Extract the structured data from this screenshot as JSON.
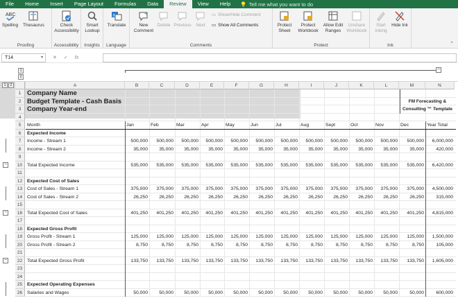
{
  "menu": {
    "tabs": [
      "File",
      "Home",
      "Insert",
      "Page Layout",
      "Formulas",
      "Data",
      "Review",
      "View",
      "Help"
    ],
    "active": "Review",
    "tell": "Tell me what you want to do"
  },
  "ribbon": {
    "proofing": {
      "spelling": "Spelling",
      "thesaurus": "Thesaurus",
      "label": "Proofing"
    },
    "accessibility": {
      "check": "Check Accessibility",
      "label": "Accessibility"
    },
    "insights": {
      "smart": "Smart Lookup",
      "label": "Insights"
    },
    "language": {
      "translate": "Translate",
      "label": "Language"
    },
    "comments": {
      "new": "New Comment",
      "delete": "Delete",
      "previous": "Previous",
      "next": "Next",
      "showhide": "Show/Hide Comment",
      "showall": "Show All Comments",
      "label": "Comments"
    },
    "protect": {
      "sheet": "Protect Sheet",
      "workbook": "Protect Workbook",
      "allow": "Allow Edit Ranges",
      "unshare": "Unshare Workbook",
      "label": "Protect"
    },
    "ink": {
      "start": "Start Inking",
      "hide": "Hide Ink",
      "label": "Ink"
    }
  },
  "formula": {
    "namebox": "T14",
    "cancel": "✕",
    "enter": "✓",
    "fx": "fx",
    "value": ""
  },
  "outline": {
    "levels_row": [
      "1",
      "2"
    ],
    "levels_col": [
      "1",
      "2"
    ]
  },
  "columns": [
    "A",
    "B",
    "C",
    "D",
    "E",
    "F",
    "G",
    "H",
    "I",
    "J",
    "K",
    "L",
    "M",
    "N"
  ],
  "rows": [
    {
      "n": "1",
      "a": "Company Name",
      "style": "big"
    },
    {
      "n": "2",
      "a": "Budget Template - Cash Basis",
      "style": "big",
      "n_text": "FM Forecasting &"
    },
    {
      "n": "3",
      "a": "Company Year-end",
      "style": "big",
      "n_text": "Consulting ™ Template"
    },
    {
      "n": "4",
      "a": ""
    },
    {
      "n": "5",
      "a": "Month",
      "months": [
        "Jan",
        "Feb",
        "Mar",
        "Apr",
        "May",
        "Jun",
        "Jul",
        "Aug",
        "Sept",
        "Oct",
        "Nov",
        "Dec"
      ],
      "total": "Year Total"
    },
    {
      "n": "6",
      "a": "Expected Income",
      "style": "bold"
    },
    {
      "n": "7",
      "a": "Income - Stream 1",
      "shade": true,
      "vals": [
        "500,000",
        "500,000",
        "500,000",
        "500,000",
        "500,000",
        "500,000",
        "500,000",
        "500,000",
        "500,000",
        "500,000",
        "500,000",
        "500,000"
      ],
      "total": "6,000,000"
    },
    {
      "n": "8",
      "a": "Income - Stream 2",
      "shade": true,
      "vals": [
        "35,000",
        "35,000",
        "35,000",
        "35,000",
        "35,000",
        "35,000",
        "35,000",
        "35,000",
        "35,000",
        "35,000",
        "35,000",
        "35,000"
      ],
      "total": "420,000"
    },
    {
      "n": "9",
      "a": ""
    },
    {
      "n": "10",
      "a": "Total Expected Income",
      "vals": [
        "535,000",
        "535,000",
        "535,000",
        "535,000",
        "535,000",
        "535,000",
        "535,000",
        "535,000",
        "535,000",
        "535,000",
        "535,000",
        "535,000"
      ],
      "total": "6,420,000"
    },
    {
      "n": "11",
      "a": ""
    },
    {
      "n": "12",
      "a": "Expected Cost of Sales",
      "style": "bold"
    },
    {
      "n": "13",
      "a": "Cost of Sales - Stream 1",
      "shade": true,
      "vals": [
        "375,000",
        "375,000",
        "375,000",
        "375,000",
        "375,000",
        "375,000",
        "375,000",
        "375,000",
        "375,000",
        "375,000",
        "375,000",
        "375,000"
      ],
      "total": "4,500,000"
    },
    {
      "n": "14",
      "a": "Cost of Sales - Stream 2",
      "shade": true,
      "vals": [
        "26,250",
        "26,250",
        "26,250",
        "26,250",
        "26,250",
        "26,250",
        "26,250",
        "26,250",
        "26,250",
        "26,250",
        "26,250",
        "26,250"
      ],
      "total": "315,000"
    },
    {
      "n": "15",
      "a": ""
    },
    {
      "n": "16",
      "a": "Total Expected Cost of Sales",
      "vals": [
        "401,250",
        "401,250",
        "401,250",
        "401,250",
        "401,250",
        "401,250",
        "401,250",
        "401,250",
        "401,250",
        "401,250",
        "401,250",
        "401,250"
      ],
      "total": "4,815,000"
    },
    {
      "n": "17",
      "a": ""
    },
    {
      "n": "18",
      "a": "Expected Gross Profit",
      "style": "bold"
    },
    {
      "n": "19",
      "a": "Gross Profit - Stream 1",
      "vals": [
        "125,000",
        "125,000",
        "125,000",
        "125,000",
        "125,000",
        "125,000",
        "125,000",
        "125,000",
        "125,000",
        "125,000",
        "125,000",
        "125,000"
      ],
      "total": "1,500,000"
    },
    {
      "n": "20",
      "a": "Gross Profit - Stream 2",
      "vals": [
        "8,750",
        "8,750",
        "8,750",
        "8,750",
        "8,750",
        "8,750",
        "8,750",
        "8,750",
        "8,750",
        "8,750",
        "8,750",
        "8,750"
      ],
      "total": "105,000"
    },
    {
      "n": "21",
      "a": ""
    },
    {
      "n": "22",
      "a": "Total Expected Gross Profit",
      "vals": [
        "133,750",
        "133,750",
        "133,750",
        "133,750",
        "133,750",
        "133,750",
        "133,750",
        "133,750",
        "133,750",
        "133,750",
        "133,750",
        "133,750"
      ],
      "total": "1,605,000"
    },
    {
      "n": "23",
      "a": ""
    },
    {
      "n": "24",
      "a": ""
    },
    {
      "n": "25",
      "a": "Expected Operating Expenses",
      "style": "bold"
    },
    {
      "n": "26",
      "a": "Salaries and Wages",
      "shade": true,
      "vals": [
        "50,000",
        "50,000",
        "50,000",
        "50,000",
        "50,000",
        "50,000",
        "50,000",
        "50,000",
        "50,000",
        "50,000",
        "50,000",
        "50,000"
      ],
      "total": "600,000"
    }
  ],
  "colors": {
    "excel_green": "#217346",
    "shade": "#d9d9d9",
    "header_bg": "#f0f0f0"
  }
}
